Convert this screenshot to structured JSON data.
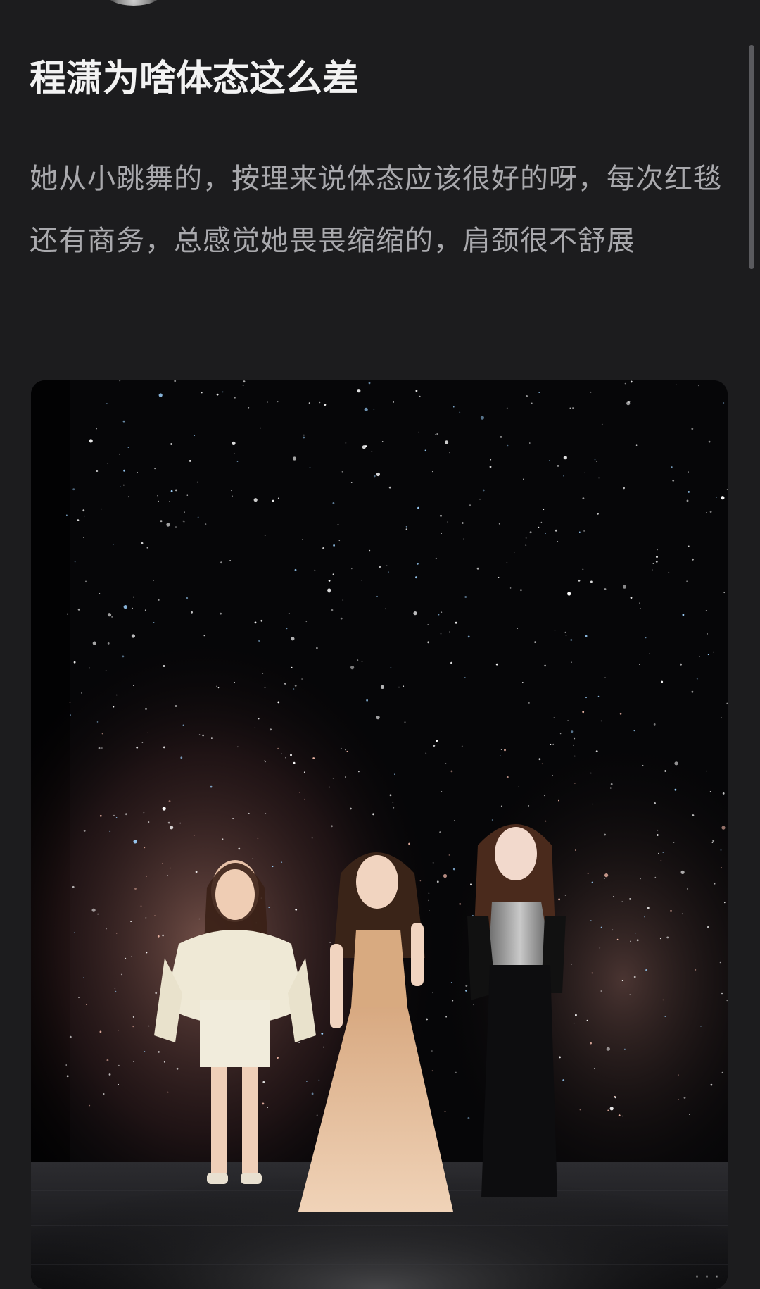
{
  "post": {
    "title": "程潇为啥体态这么差",
    "body": "她从小跳舞的，按理来说体态应该很好的呀，每次红毯还有商务，总感觉她畏畏缩缩的，肩颈很不舒展"
  },
  "photo": {
    "alt": "stage-photo"
  }
}
